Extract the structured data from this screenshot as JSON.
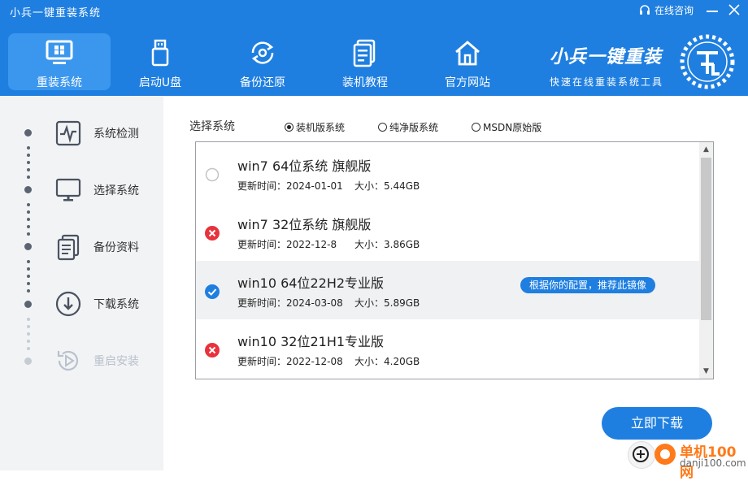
{
  "app": {
    "title": "小兵一键重装系统"
  },
  "window": {
    "consult_label": "在线咨询"
  },
  "tabs": [
    {
      "label": "重装系统",
      "icon": "monitor-icon",
      "active": true
    },
    {
      "label": "启动U盘",
      "icon": "usb-icon",
      "active": false
    },
    {
      "label": "备份还原",
      "icon": "backup-icon",
      "active": false
    },
    {
      "label": "装机教程",
      "icon": "tutorial-icon",
      "active": false
    },
    {
      "label": "官方网站",
      "icon": "home-icon",
      "active": false
    }
  ],
  "brand": {
    "name": "小兵一键重装",
    "slogan": "快速在线重装系统工具"
  },
  "steps": [
    {
      "label": "系统检测",
      "icon": "pulse-icon",
      "done": true
    },
    {
      "label": "选择系统",
      "icon": "monitor-icon",
      "done": true
    },
    {
      "label": "备份资料",
      "icon": "document-icon",
      "done": true
    },
    {
      "label": "下载系统",
      "icon": "download-icon",
      "done": true
    },
    {
      "label": "重启安装",
      "icon": "restart-icon",
      "done": false
    }
  ],
  "select": {
    "label": "选择系统",
    "options": [
      {
        "label": "装机版系统",
        "checked": true
      },
      {
        "label": "纯净版系统",
        "checked": false
      },
      {
        "label": "MSDN原始版",
        "checked": false
      }
    ]
  },
  "systems": [
    {
      "name": "win7 64位系统 旗舰版",
      "update_label": "更新时间：",
      "date": "2024-01-01",
      "size_label": "大小：",
      "size": "5.44GB",
      "status": "available"
    },
    {
      "name": "win7 32位系统 旗舰版",
      "update_label": "更新时间：",
      "date": "2022-12-8",
      "size_label": "大小：",
      "size": "3.86GB",
      "status": "unavailable"
    },
    {
      "name": "win10 64位22H2专业版",
      "update_label": "更新时间：",
      "date": "2024-03-08",
      "size_label": "大小：",
      "size": "5.89GB",
      "status": "selected",
      "tip": "根据你的配置，推荐此镜像"
    },
    {
      "name": "win10 32位21H1专业版",
      "update_label": "更新时间：",
      "date": "2022-12-08",
      "size_label": "大小：",
      "size": "4.20GB",
      "status": "unavailable"
    }
  ],
  "download_button": "立即下载",
  "watermark": {
    "line1": "单机100网",
    "line2": "danji100.com"
  },
  "colors": {
    "primary": "#1f7fe0",
    "tab_active": "#3b97ee",
    "error": "#e8323c",
    "sidebar_bg": "#f2f3f5"
  }
}
